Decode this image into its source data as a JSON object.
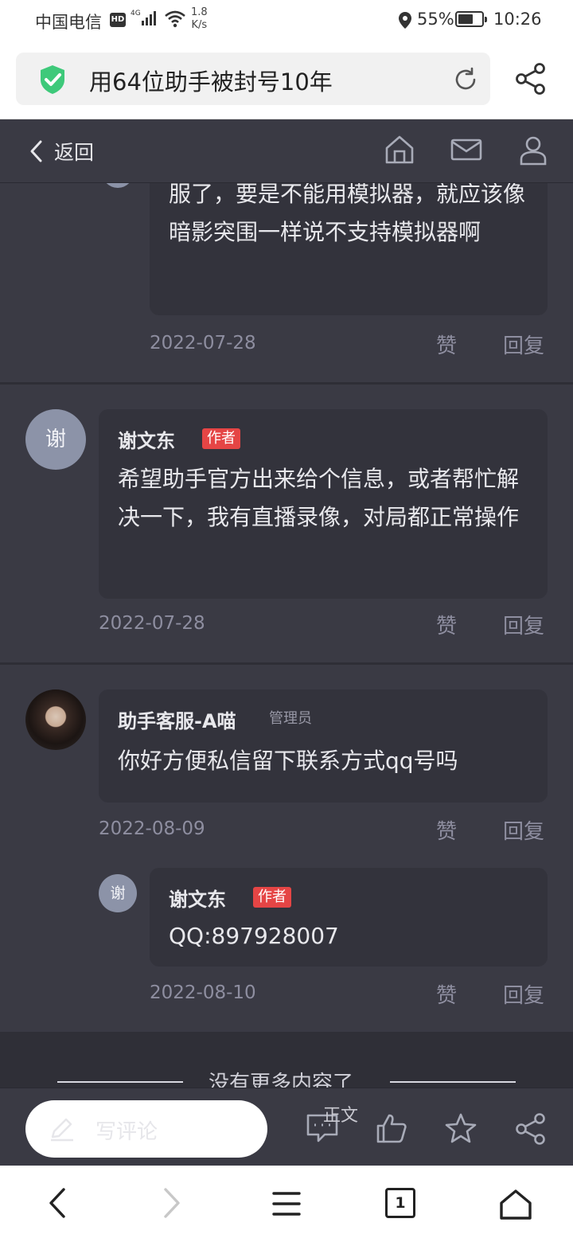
{
  "status_bar": {
    "carrier": "中国电信",
    "hd_badge": "HD",
    "network": "4G",
    "speed_value": "1.8",
    "speed_unit": "K/s",
    "battery": "55%",
    "battery_level": 0.55,
    "time": "10:26"
  },
  "address_bar": {
    "page_title": "用64位助手被封号10年",
    "icons": [
      "shield-check-icon",
      "reload-icon",
      "share-icon"
    ]
  },
  "page_nav": {
    "back_label": "返回",
    "icons": [
      "home-icon",
      "mail-icon",
      "user-icon"
    ]
  },
  "comments": [
    {
      "id": "c0",
      "text": "服了，要是不能用模拟器，就应该像暗影突围一样说不支持模拟器啊",
      "date": "2022-07-28",
      "like_label": "赞",
      "reply_label": "回复"
    },
    {
      "id": "c1",
      "avatar_char": "谢",
      "name": "谢文东",
      "tag": "作者",
      "text": "希望助手官方出来给个信息，或者帮忙解决一下，我有直播录像，对局都正常操作",
      "date": "2022-07-28",
      "like_label": "赞",
      "reply_label": "回复"
    },
    {
      "id": "c2",
      "name": "助手客服-A喵",
      "tag": "管理员",
      "text": "你好方便私信留下联系方式qq号吗",
      "date": "2022-08-09",
      "like_label": "赞",
      "reply_label": "回复",
      "replies": [
        {
          "avatar_char": "谢",
          "name": "谢文东",
          "tag": "作者",
          "text": "QQ:897928007",
          "date": "2022-08-10",
          "like_label": "赞",
          "reply_label": "回复"
        }
      ]
    }
  ],
  "footer": {
    "no_more": "没有更多内容了"
  },
  "comment_bar": {
    "write_label": "写评论",
    "article_label": "正文",
    "icons": [
      "pen-icon",
      "comment-icon",
      "thumbs-up-icon",
      "star-icon",
      "share-icon"
    ]
  },
  "browser_nav": {
    "tab_count": "1",
    "icons": [
      "back-arrow-icon",
      "forward-arrow-icon",
      "menu-icon",
      "tabs-icon",
      "home-icon"
    ]
  }
}
